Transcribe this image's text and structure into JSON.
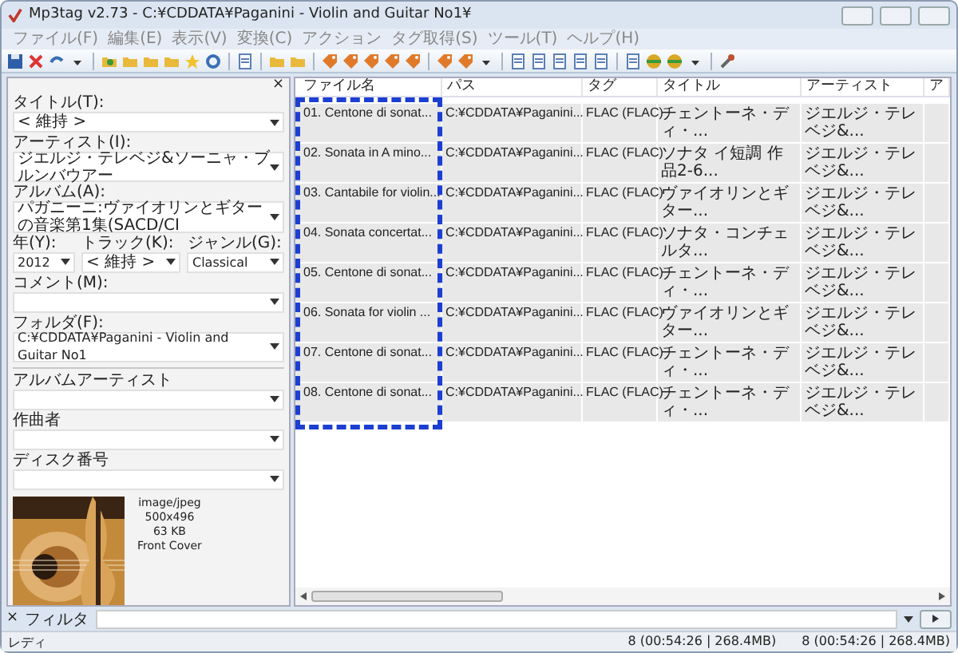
{
  "window": {
    "title": "Mp3tag v2.73  -  C:¥CDDATA¥Paganini - Violin and Guitar No1¥"
  },
  "menu": [
    "ファイル(F)",
    "編集(E)",
    "表示(V)",
    "変換(C)",
    "アクション",
    "タグ取得(S)",
    "ツール(T)",
    "ヘルプ(H)"
  ],
  "tag_panel": {
    "close": "×",
    "fields": [
      {
        "kind": "single",
        "label": "タイトル(T):",
        "value": "< 維持 >"
      },
      {
        "kind": "single",
        "label": "アーティスト(I):",
        "value": "ジエルジ・テレベジ&ソーニャ・ブルンバウアー"
      },
      {
        "kind": "single",
        "label": "アルバム(A):",
        "value": "パガニーニ:ヴァイオリンとギターの音楽第1集(SACD/CI"
      },
      {
        "kind": "triple",
        "items": [
          {
            "label": "年(Y):",
            "value": "2012"
          },
          {
            "label": "トラック(K):",
            "value": "< 維持 >"
          },
          {
            "label": "ジャンル(G):",
            "value": "Classical"
          }
        ]
      },
      {
        "kind": "single",
        "label": "コメント(M):"
      },
      {
        "kind": "single",
        "label": "フォルダ(F):",
        "value": "C:¥CDDATA¥Paganini - Violin and Guitar No1"
      },
      {
        "kind": "separator"
      },
      {
        "kind": "single",
        "label": "アルバムアーティスト"
      },
      {
        "kind": "single",
        "label": "作曲者"
      },
      {
        "kind": "single",
        "label": "ディスク番号"
      }
    ],
    "cover": {
      "kind": "picture",
      "info": [
        "image/jpeg",
        "500x496",
        "63 KB",
        "Front Cover"
      ]
    }
  },
  "file_list": {
    "columns": [
      "ファイル名",
      "パス",
      "タグ",
      "タイトル",
      "アーティスト",
      "ア"
    ],
    "rows": [
      {
        "selected": true,
        "cells": [
          "01. Centone di sonat...",
          "C:¥CDDATA¥Paganini...",
          "FLAC (FLAC)",
          "チェントーネ・ディ・...",
          "ジエルジ・テレベジ&..."
        ]
      },
      {
        "selected": true,
        "cells": [
          "02. Sonata in A mino...",
          "C:¥CDDATA¥Paganini...",
          "FLAC (FLAC)",
          "ソナタ イ短調 作品2-6...",
          "ジエルジ・テレベジ&..."
        ]
      },
      {
        "selected": true,
        "cells": [
          "03. Cantabile for violin...",
          "C:¥CDDATA¥Paganini...",
          "FLAC (FLAC)",
          "ヴァイオリンとギター...",
          "ジエルジ・テレベジ&..."
        ]
      },
      {
        "selected": true,
        "cells": [
          "04. Sonata concertat...",
          "C:¥CDDATA¥Paganini...",
          "FLAC (FLAC)",
          "ソナタ・コンチェルタ...",
          "ジエルジ・テレベジ&..."
        ]
      },
      {
        "selected": true,
        "cells": [
          "05. Centone di sonat...",
          "C:¥CDDATA¥Paganini...",
          "FLAC (FLAC)",
          "チェントーネ・ディ・...",
          "ジエルジ・テレベジ&..."
        ]
      },
      {
        "selected": true,
        "cells": [
          "06. Sonata for violin ...",
          "C:¥CDDATA¥Paganini...",
          "FLAC (FLAC)",
          "ヴァイオリンとギター...",
          "ジエルジ・テレベジ&..."
        ]
      },
      {
        "selected": true,
        "cells": [
          "07. Centone di sonat...",
          "C:¥CDDATA¥Paganini...",
          "FLAC (FLAC)",
          "チェントーネ・ディ・...",
          "ジエルジ・テレベジ&..."
        ]
      },
      {
        "selected": true,
        "cells": [
          "08. Centone di sonat...",
          "C:¥CDDATA¥Paganini...",
          "FLAC (FLAC)",
          "チェントーネ・ディ・...",
          "ジエルジ・テレベジ&..."
        ]
      }
    ]
  },
  "filter_bar": {
    "close": "×",
    "label": "フィルタ"
  },
  "status_bar": [
    "レディ",
    "8 (00:54:26 | 268.4MB)",
    "8 (00:54:26 | 268.4MB)"
  ]
}
